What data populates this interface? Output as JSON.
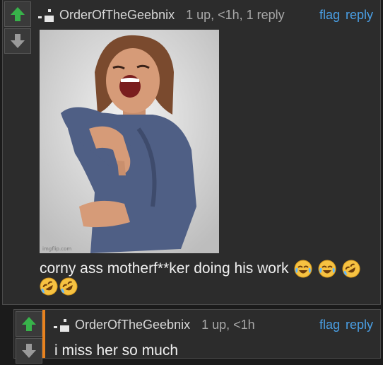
{
  "comments": [
    {
      "username": "OrderOfTheGeebnix",
      "stats": "1 up, <1h, 1 reply",
      "actions": [
        "flag",
        "reply"
      ],
      "text": "corny ass motherf**ker doing his work",
      "image_watermark": "imgflip.com",
      "emojis": [
        "laughing-tears",
        "laughing-tears",
        "rolling-laughing",
        "rolling-laughing",
        "rolling-laughing"
      ]
    },
    {
      "username": "OrderOfTheGeebnix",
      "stats": "1 up, <1h",
      "actions": [
        "flag",
        "reply"
      ],
      "text": "i miss her so much"
    }
  ],
  "colors": {
    "upvote_active": "#38b24a",
    "reply_accent": "#e8821e",
    "link": "#4aa0e6"
  }
}
